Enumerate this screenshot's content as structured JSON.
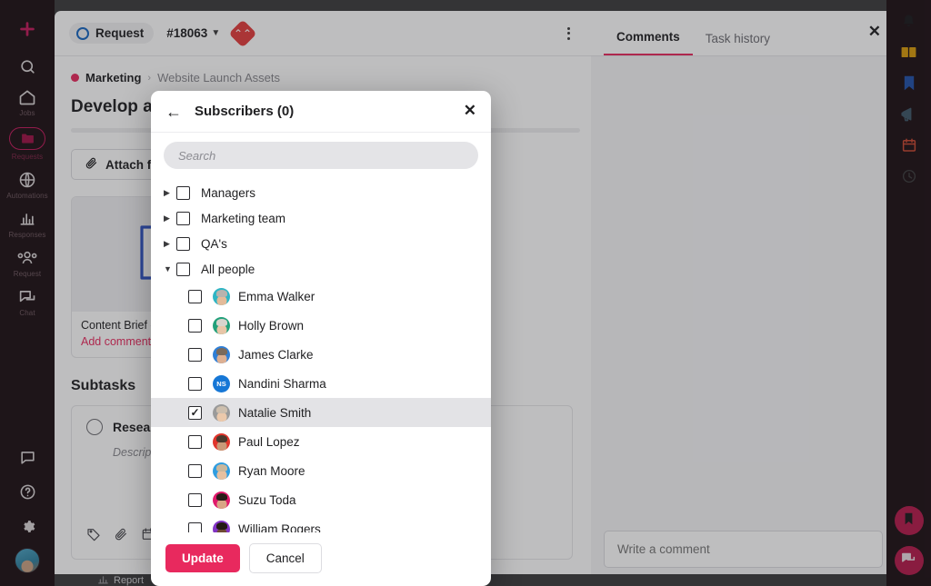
{
  "left_rail": {
    "add_label": "add-icon",
    "items": [
      {
        "icon": "search-icon",
        "label": ""
      },
      {
        "icon": "home-icon",
        "label": "Jobs"
      },
      {
        "icon": "folder-icon",
        "label": "Requests",
        "active": true
      },
      {
        "icon": "globe-icon",
        "label": "Automations"
      },
      {
        "icon": "chart-icon",
        "label": "Responses"
      },
      {
        "icon": "people-icon",
        "label": "Request"
      },
      {
        "icon": "chat-icon",
        "label": "Chat"
      }
    ],
    "bottom_items": [
      {
        "icon": "feedback-icon",
        "label": ""
      },
      {
        "icon": "help-icon",
        "label": ""
      },
      {
        "icon": "settings-icon",
        "label": ""
      }
    ]
  },
  "header": {
    "status_label": "Request",
    "task_id": "#18063",
    "priority_icon": "high-priority-icon",
    "menu_icon": "kebab-menu-icon"
  },
  "breadcrumb": {
    "project": "Marketing",
    "separator": "›",
    "folder": "Website Launch Assets"
  },
  "task": {
    "title": "Develop a B",
    "attach_label": "Attach file",
    "file": {
      "type": "word-document-icon",
      "name": "Content Brief -",
      "comment_link": "Add comment"
    },
    "subtasks_heading": "Subtasks",
    "subtask": {
      "name": "Research",
      "description": "Descript"
    },
    "subtask_icons": [
      "tag-icon",
      "paperclip-icon",
      "calendar-icon",
      "assignee-icon"
    ]
  },
  "right_panel": {
    "tabs": [
      {
        "label": "Comments",
        "active": true
      },
      {
        "label": "Task history",
        "active": false
      }
    ],
    "close_icon": "close-icon",
    "comment_placeholder": "Write a comment"
  },
  "right_rail": {
    "items": [
      {
        "icon": "bell-icon",
        "color": "#1f1f21"
      },
      {
        "icon": "book-icon",
        "color": "#d79a0a"
      },
      {
        "icon": "bookmark-icon",
        "color": "#1f4fa8"
      },
      {
        "icon": "megaphone-icon",
        "color": "#3c5566"
      },
      {
        "icon": "calendar-icon",
        "color": "#c8452f"
      },
      {
        "icon": "clock-icon",
        "color": "#3a3a3c"
      }
    ],
    "round_buttons": [
      {
        "icon": "bookmark-filled-icon"
      },
      {
        "icon": "chat-bubble-icon"
      }
    ]
  },
  "modal": {
    "back_icon": "back-arrow-icon",
    "title": "Subscribers (0)",
    "close_icon": "close-icon",
    "search_placeholder": "Search",
    "groups": [
      {
        "label": "Managers",
        "expanded": false,
        "checked": false
      },
      {
        "label": "Marketing team",
        "expanded": false,
        "checked": false
      },
      {
        "label": "QA's",
        "expanded": false,
        "checked": false
      },
      {
        "label": "All people",
        "expanded": true,
        "checked": false
      }
    ],
    "people": [
      {
        "name": "Emma Walker",
        "checked": false,
        "avatar_type": "photo",
        "color": "#2fb5c4",
        "hair": "#b8b3ae",
        "skin": "#e3bb9a"
      },
      {
        "name": "Holly Brown",
        "checked": false,
        "avatar_type": "photo",
        "color": "#22a07a",
        "hair": "#d8d4cd",
        "skin": "#e8c6a8"
      },
      {
        "name": "James Clarke",
        "checked": false,
        "avatar_type": "photo",
        "color": "#2f7fd6",
        "hair": "#7a6a5c",
        "skin": "#ddb093"
      },
      {
        "name": "Nandini Sharma",
        "checked": false,
        "avatar_type": "initials",
        "initials": "NS",
        "color": "#1677d6"
      },
      {
        "name": "Natalie Smith",
        "checked": true,
        "avatar_type": "photo",
        "color": "#9a9a9a",
        "hair": "#cdbfae",
        "skin": "#ecc9ab"
      },
      {
        "name": "Paul Lopez",
        "checked": false,
        "avatar_type": "photo",
        "color": "#e0342b",
        "hair": "#4a3a2e",
        "skin": "#c99a78"
      },
      {
        "name": "Ryan Moore",
        "checked": false,
        "avatar_type": "photo",
        "color": "#2f9de0",
        "hair": "#c9b79c",
        "skin": "#e6c0a0"
      },
      {
        "name": "Suzu Toda",
        "checked": false,
        "avatar_type": "photo",
        "color": "#e0196b",
        "hair": "#2a1c18",
        "skin": "#d8a585"
      },
      {
        "name": "William Rogers",
        "checked": false,
        "avatar_type": "photo",
        "color": "#8234c4",
        "hair": "#241a14",
        "skin": "#6e4a33"
      }
    ],
    "update_label": "Update",
    "cancel_label": "Cancel"
  },
  "bottom_bar": {
    "report_label": "Report",
    "report_icon": "report-icon"
  },
  "colors": {
    "accent": "#e8295e",
    "rail_bg": "#1b0d12",
    "page_bg": "#3a3a3c"
  }
}
